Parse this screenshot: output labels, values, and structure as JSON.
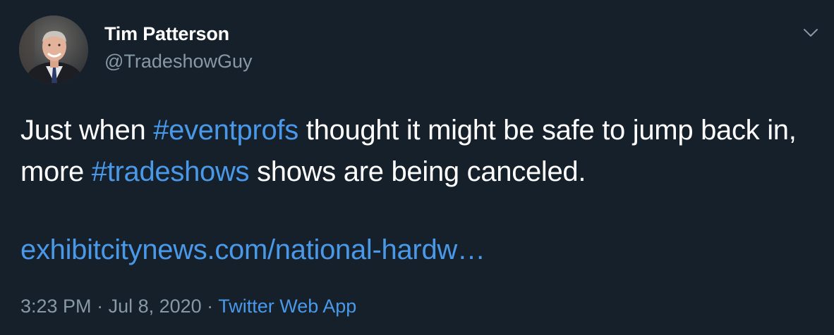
{
  "author": {
    "name": "Tim Patterson",
    "handle": "@TradeshowGuy"
  },
  "tweet": {
    "text_1": "Just when ",
    "hashtag_1": "#eventprofs",
    "text_2": " thought it might be safe to jump back in, more ",
    "hashtag_2": "#tradeshows",
    "text_3": " shows are being canceled.",
    "link": "exhibitcitynews.com/national-hardw…"
  },
  "meta": {
    "time": "3:23 PM",
    "separator_1": " · ",
    "date": "Jul 8, 2020",
    "separator_2": " · ",
    "source": "Twitter Web App"
  },
  "icons": {
    "menu": "chevron-down-icon"
  },
  "colors": {
    "background": "#15202b",
    "accent": "#4a99e9",
    "secondary_text": "#8899a6",
    "primary_text": "#ffffff"
  }
}
